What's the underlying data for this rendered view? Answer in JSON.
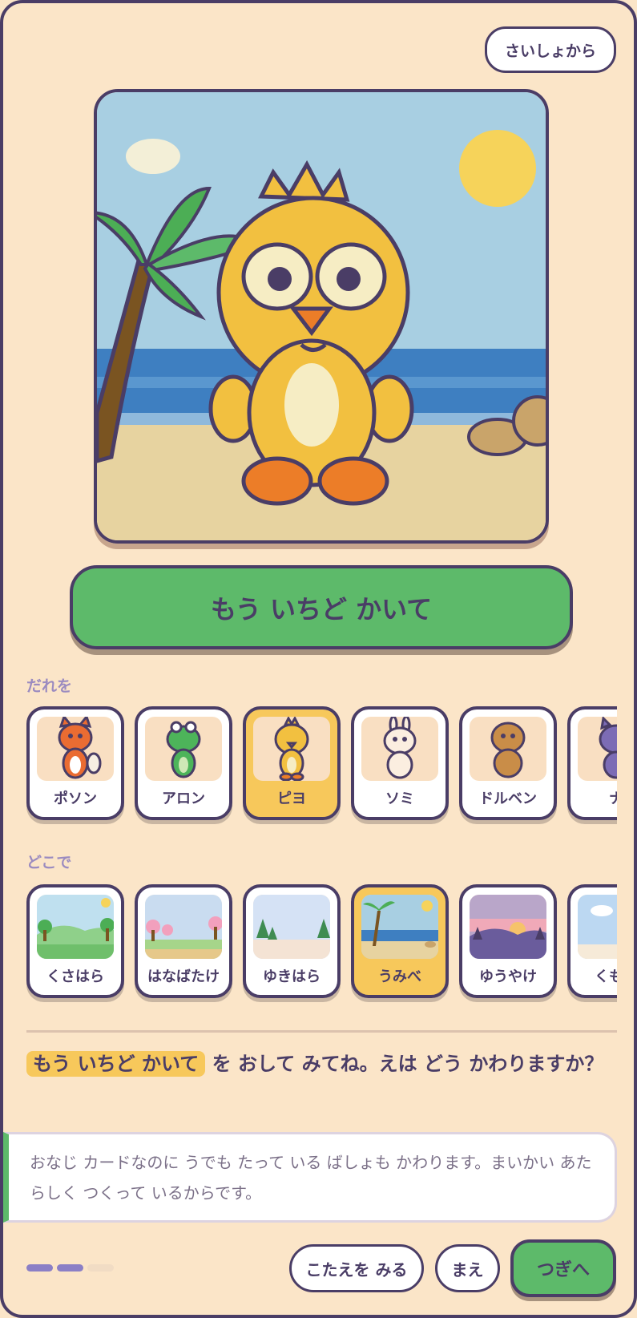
{
  "header": {
    "restart_label": "さいしょから"
  },
  "scene": {
    "character": "ピヨ",
    "place": "うみべ"
  },
  "actions": {
    "draw_again_label": "もう いちど かいて"
  },
  "who": {
    "label": "だれを",
    "items": [
      {
        "label": "ポソン",
        "icon": "fox-icon",
        "color": "#ea6c32",
        "selected": false
      },
      {
        "label": "アロン",
        "icon": "frog-icon",
        "color": "#4db45a",
        "selected": false
      },
      {
        "label": "ピヨ",
        "icon": "chick-icon",
        "color": "#f2c040",
        "selected": true
      },
      {
        "label": "ソミ",
        "icon": "bunny-icon",
        "color": "#fbeee0",
        "selected": false
      },
      {
        "label": "ドルベン",
        "icon": "bear-icon",
        "color": "#c98d48",
        "selected": false
      },
      {
        "label": "ナ",
        "icon": "cat-icon",
        "color": "#7c6cb5",
        "selected": false
      }
    ]
  },
  "where": {
    "label": "どこで",
    "items": [
      {
        "label": "くさはら",
        "icon": "meadow-icon",
        "selected": false
      },
      {
        "label": "はなばたけ",
        "icon": "flower-field-icon",
        "selected": false
      },
      {
        "label": "ゆきはら",
        "icon": "snowfield-icon",
        "selected": false
      },
      {
        "label": "うみべ",
        "icon": "beach-icon",
        "selected": true
      },
      {
        "label": "ゆうやけ",
        "icon": "sunset-icon",
        "selected": false
      },
      {
        "label": "くもの",
        "icon": "cloud-icon",
        "selected": false
      }
    ]
  },
  "question": {
    "highlight": "もう いちど かいて",
    "rest": " を おして みてね。えは どう かわりますか？"
  },
  "answer": {
    "text": "おなじ カードなのに うでも たって いる ばしょも かわります。まいかい あたらしく つくって いるからです。"
  },
  "progress": {
    "current": 2,
    "total": 3,
    "active_color": "#8b7fc6",
    "inactive_color": "#f1dcc4"
  },
  "footer": {
    "show_answer_label": "こたえを みる",
    "prev_label": "まえ",
    "next_label": "つぎへ"
  },
  "colors": {
    "outline": "#4a3d66",
    "green": "#5dba6a",
    "highlight": "#f7c85b",
    "background": "#fbe5c8"
  }
}
